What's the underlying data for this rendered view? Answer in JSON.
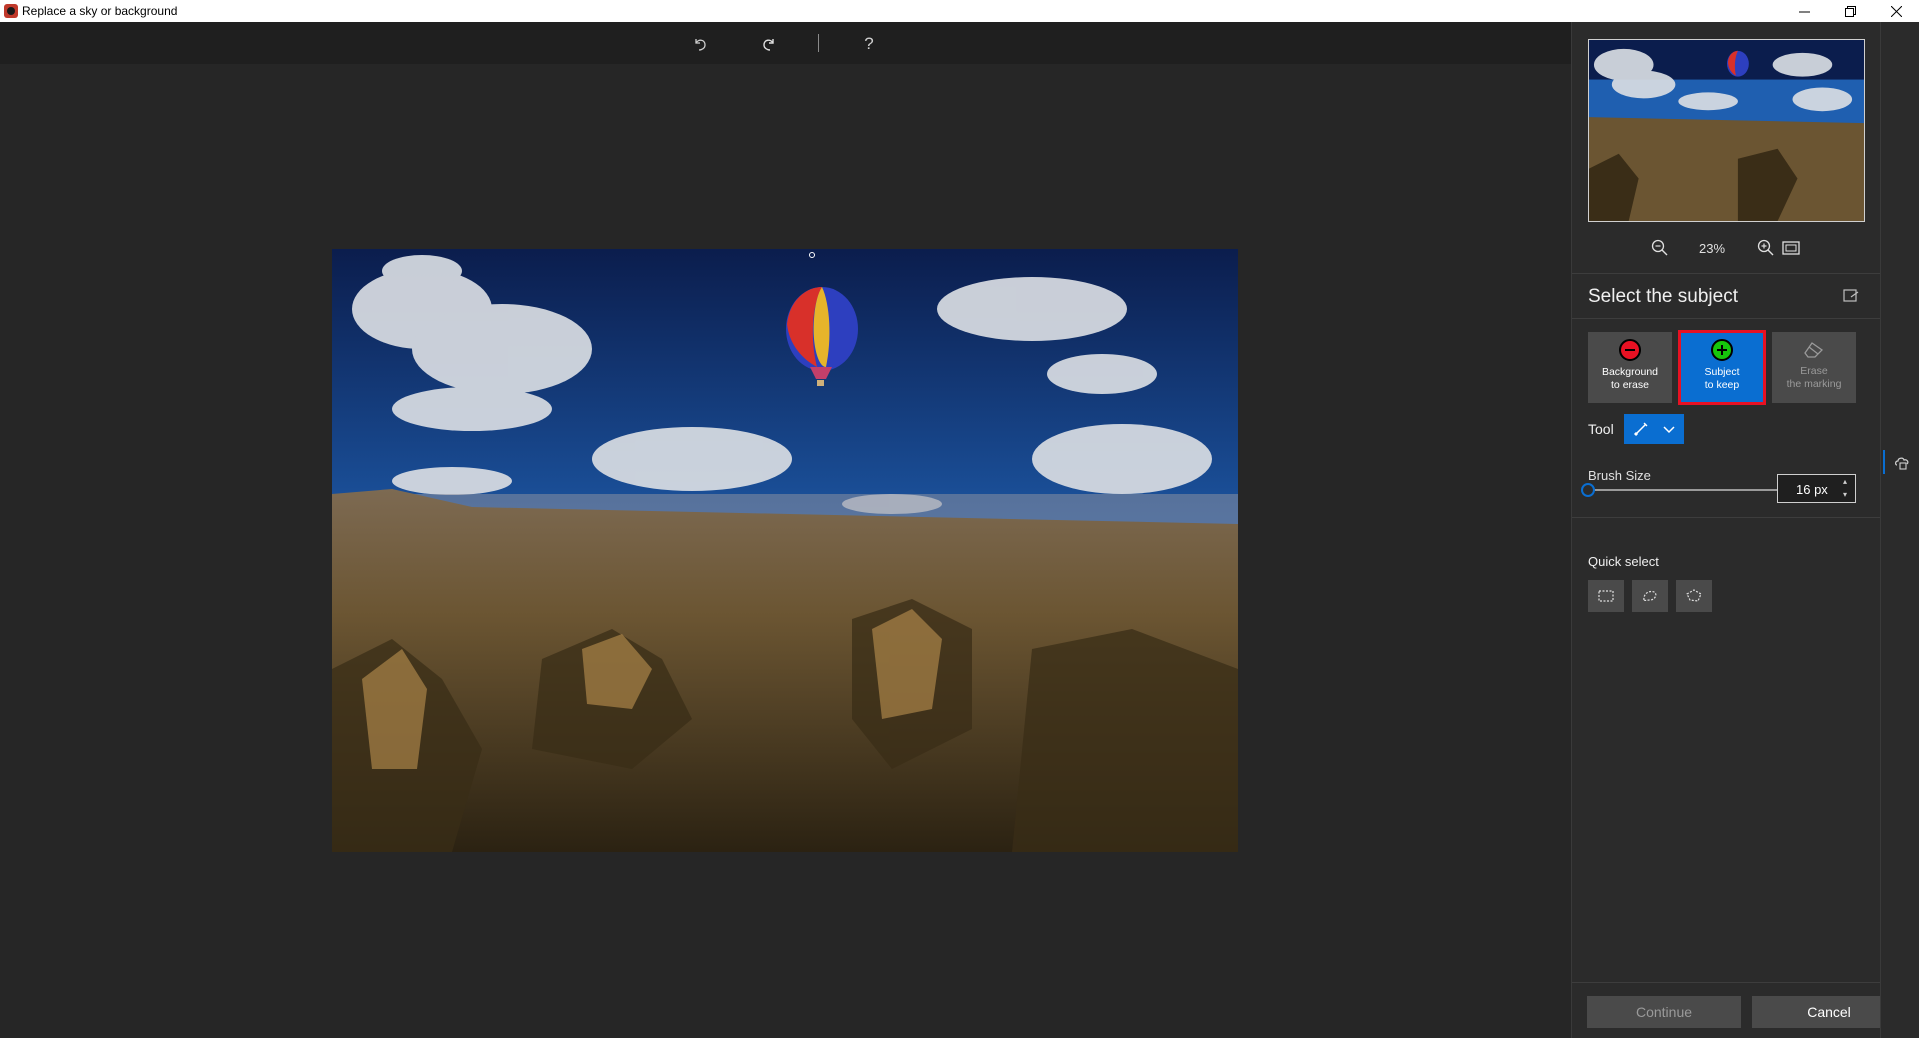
{
  "window": {
    "title": "Replace a sky or background",
    "minimize_icon": "minimize-icon",
    "restore_icon": "restore-icon",
    "close_icon": "close-icon"
  },
  "toolbar": {
    "undo_icon": "undo-icon",
    "redo_icon": "redo-icon",
    "help_label": "?"
  },
  "navigator": {
    "zoom_level": "23%",
    "zoom_out_icon": "zoom-out-icon",
    "zoom_in_icon": "zoom-in-icon",
    "fit_icon": "fit-to-screen-icon"
  },
  "panel": {
    "title": "Select the subject",
    "modes": [
      {
        "line1": "Background",
        "line2": "to erase",
        "icon": "minus-circle-icon",
        "color": "#e81123"
      },
      {
        "line1": "Subject",
        "line2": "to keep",
        "icon": "plus-circle-icon",
        "color": "#16c60c",
        "selected": true
      },
      {
        "line1": "Erase",
        "line2": "the marking",
        "icon": "eraser-icon",
        "disabled": true
      }
    ],
    "tool_label": "Tool",
    "tool_icon": "brush-icon",
    "brush_size_label": "Brush Size",
    "brush_size_value": "16 px",
    "brush_size_fraction": 0.0,
    "quick_select_label": "Quick select",
    "quick_select_tools": [
      "rectangle-select-icon",
      "lasso-select-icon",
      "polygon-lasso-icon"
    ]
  },
  "footer": {
    "continue_label": "Continue",
    "cancel_label": "Cancel"
  },
  "colors": {
    "accent": "#0a6ed1",
    "highlight": "#e81123",
    "panel_bg": "#2b2b2b",
    "canvas_bg": "#262626"
  }
}
